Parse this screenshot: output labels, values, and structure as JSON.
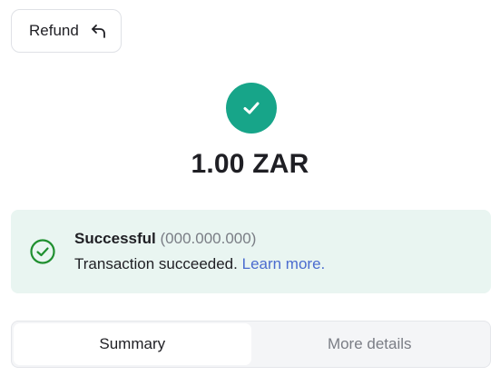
{
  "header": {
    "refund_label": "Refund"
  },
  "transaction": {
    "amount": "1.00 ZAR",
    "status_title": "Successful",
    "status_code": "(000.000.000)",
    "status_message": "Transaction succeeded.",
    "learn_more": "Learn more."
  },
  "tabs": [
    {
      "label": "Summary",
      "active": true
    },
    {
      "label": "More details",
      "active": false
    }
  ],
  "icons": {
    "refund": "undo-arrow-icon",
    "success": "check-icon",
    "status": "check-circle-icon"
  },
  "colors": {
    "success_green": "#17a589",
    "status_icon_green": "#1f8f2f",
    "card_background": "#e9f5f1",
    "link_blue": "#4b6ccf"
  }
}
